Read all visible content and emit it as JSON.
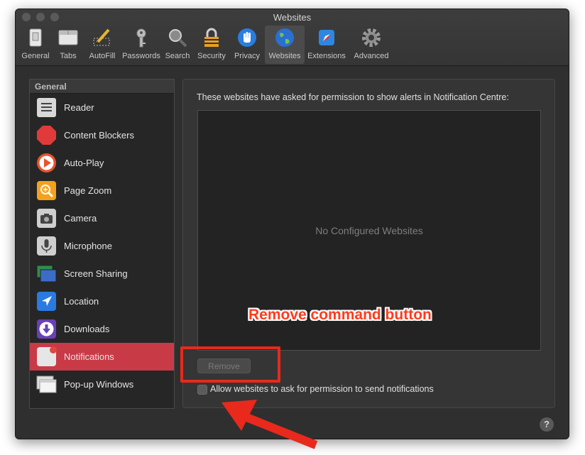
{
  "window": {
    "title": "Websites"
  },
  "toolbar": {
    "items": [
      {
        "label": "General",
        "icon": "general-switch-icon"
      },
      {
        "label": "Tabs",
        "icon": "tabs-icon"
      },
      {
        "label": "AutoFill",
        "icon": "autofill-pencil-icon"
      },
      {
        "label": "Passwords",
        "icon": "key-icon"
      },
      {
        "label": "Search",
        "icon": "magnifier-icon"
      },
      {
        "label": "Security",
        "icon": "lock-icon"
      },
      {
        "label": "Privacy",
        "icon": "hand-icon"
      },
      {
        "label": "Websites",
        "icon": "globe-icon",
        "active": true
      },
      {
        "label": "Extensions",
        "icon": "extensions-icon"
      },
      {
        "label": "Advanced",
        "icon": "gear-icon"
      }
    ]
  },
  "sidebar": {
    "header": "General",
    "items": [
      {
        "label": "Reader",
        "icon": "reader-icon"
      },
      {
        "label": "Content Blockers",
        "icon": "stop-sign-icon"
      },
      {
        "label": "Auto-Play",
        "icon": "play-icon"
      },
      {
        "label": "Page Zoom",
        "icon": "zoom-icon"
      },
      {
        "label": "Camera",
        "icon": "camera-icon"
      },
      {
        "label": "Microphone",
        "icon": "microphone-icon"
      },
      {
        "label": "Screen Sharing",
        "icon": "screen-sharing-icon"
      },
      {
        "label": "Location",
        "icon": "location-arrow-icon"
      },
      {
        "label": "Downloads",
        "icon": "download-icon"
      },
      {
        "label": "Notifications",
        "icon": "notification-icon",
        "selected": true
      },
      {
        "label": "Pop-up Windows",
        "icon": "popup-windows-icon"
      }
    ]
  },
  "panel": {
    "description": "These websites have asked for permission to show alerts in Notification Centre:",
    "empty_text": "No Configured Websites",
    "remove_label": "Remove",
    "checkbox_label": "Allow websites to ask for permission to send notifications",
    "checkbox_checked": false
  },
  "help": {
    "label": "?"
  },
  "annotation": {
    "text": "Remove command button",
    "color": "#e8291c"
  },
  "colors": {
    "selected": "#c93a47",
    "window_bg": "#2f2f2f"
  }
}
